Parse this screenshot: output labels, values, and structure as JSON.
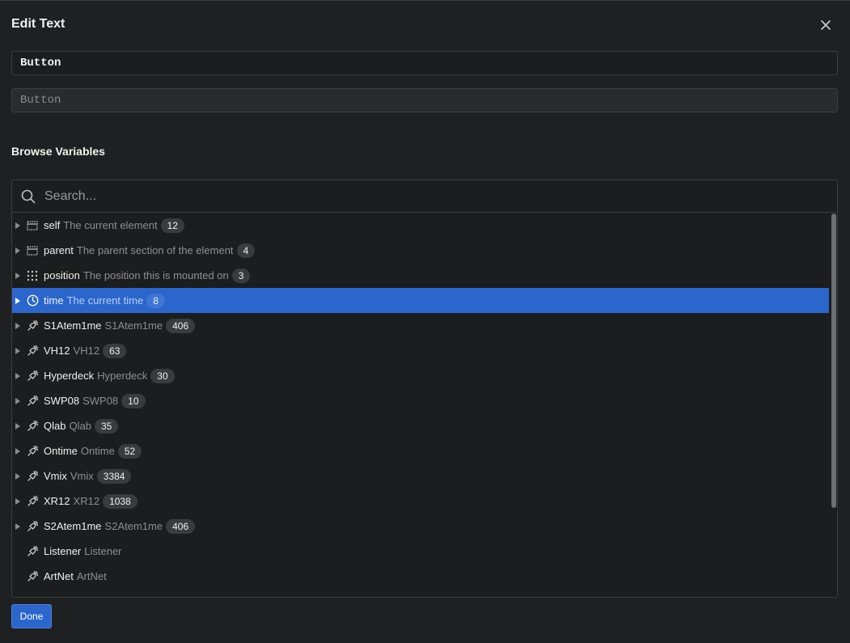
{
  "dialog": {
    "title": "Edit Text",
    "close_icon": "close-icon"
  },
  "text_field": {
    "value": "Button"
  },
  "preview_field": {
    "placeholder": "Button"
  },
  "browse": {
    "title": "Browse Variables",
    "search_placeholder": "Search...",
    "items": [
      {
        "name": "self",
        "description": "The current element",
        "count": "12",
        "icon": "frame-icon",
        "expandable": true,
        "selected": false
      },
      {
        "name": "parent",
        "description": "The parent section of the element",
        "count": "4",
        "icon": "frame-icon",
        "expandable": true,
        "selected": false
      },
      {
        "name": "position",
        "description": "The position this is mounted on",
        "count": "3",
        "icon": "grid-icon",
        "expandable": true,
        "selected": false
      },
      {
        "name": "time",
        "description": "The current time",
        "count": "8",
        "icon": "clock-icon",
        "expandable": true,
        "selected": true
      },
      {
        "name": "S1Atem1me",
        "description": "S1Atem1me",
        "count": "406",
        "icon": "plug-icon",
        "expandable": true,
        "selected": false
      },
      {
        "name": "VH12",
        "description": "VH12",
        "count": "63",
        "icon": "plug-icon",
        "expandable": true,
        "selected": false
      },
      {
        "name": "Hyperdeck",
        "description": "Hyperdeck",
        "count": "30",
        "icon": "plug-icon",
        "expandable": true,
        "selected": false
      },
      {
        "name": "SWP08",
        "description": "SWP08",
        "count": "10",
        "icon": "plug-icon",
        "expandable": true,
        "selected": false
      },
      {
        "name": "Qlab",
        "description": "Qlab",
        "count": "35",
        "icon": "plug-icon",
        "expandable": true,
        "selected": false
      },
      {
        "name": "Ontime",
        "description": "Ontime",
        "count": "52",
        "icon": "plug-icon",
        "expandable": true,
        "selected": false
      },
      {
        "name": "Vmix",
        "description": "Vmix",
        "count": "3384",
        "icon": "plug-icon",
        "expandable": true,
        "selected": false
      },
      {
        "name": "XR12",
        "description": "XR12",
        "count": "1038",
        "icon": "plug-icon",
        "expandable": true,
        "selected": false
      },
      {
        "name": "S2Atem1me",
        "description": "S2Atem1me",
        "count": "406",
        "icon": "plug-icon",
        "expandable": true,
        "selected": false
      },
      {
        "name": "Listener",
        "description": "Listener",
        "count": "",
        "icon": "plug-icon",
        "expandable": false,
        "selected": false
      },
      {
        "name": "ArtNet",
        "description": "ArtNet",
        "count": "",
        "icon": "plug-icon",
        "expandable": false,
        "selected": false
      }
    ]
  },
  "footer": {
    "done_label": "Done"
  },
  "colors": {
    "accent": "#2b66cc",
    "background": "#1f2021"
  }
}
